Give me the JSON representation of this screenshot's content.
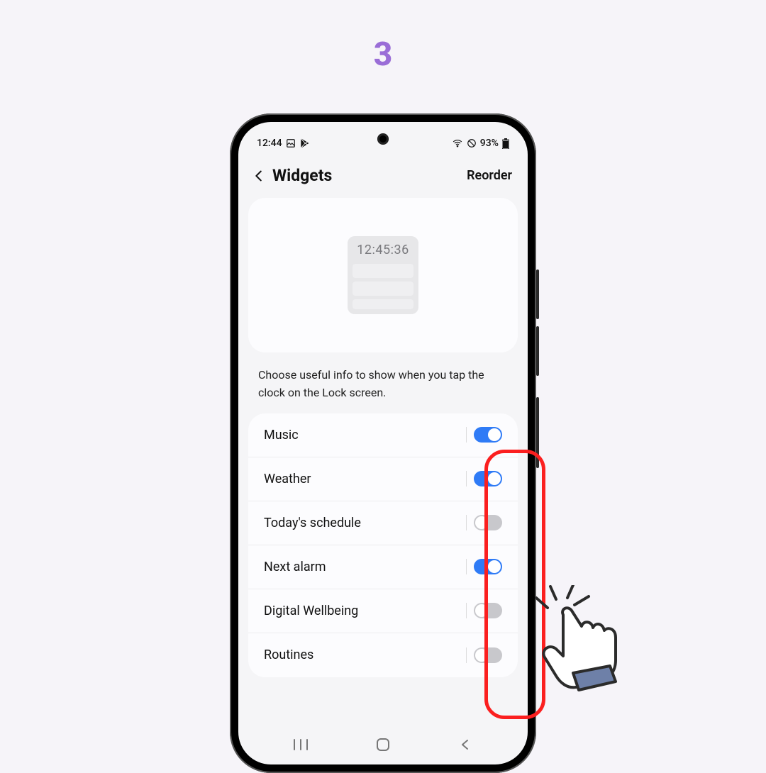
{
  "step": "3",
  "status": {
    "time": "12:44",
    "battery": "93%"
  },
  "header": {
    "title": "Widgets",
    "action": "Reorder"
  },
  "preview": {
    "clock": "12:45:36"
  },
  "hint": "Choose useful info to show when you tap the clock on the Lock screen.",
  "widgets": [
    {
      "label": "Music",
      "on": true
    },
    {
      "label": "Weather",
      "on": true
    },
    {
      "label": "Today's schedule",
      "on": false
    },
    {
      "label": "Next alarm",
      "on": true
    },
    {
      "label": "Digital Wellbeing",
      "on": false
    },
    {
      "label": "Routines",
      "on": false
    }
  ],
  "colors": {
    "accent": "#2f7bf6",
    "step": "#9a6dd7",
    "highlight": "#fb1f1f"
  }
}
